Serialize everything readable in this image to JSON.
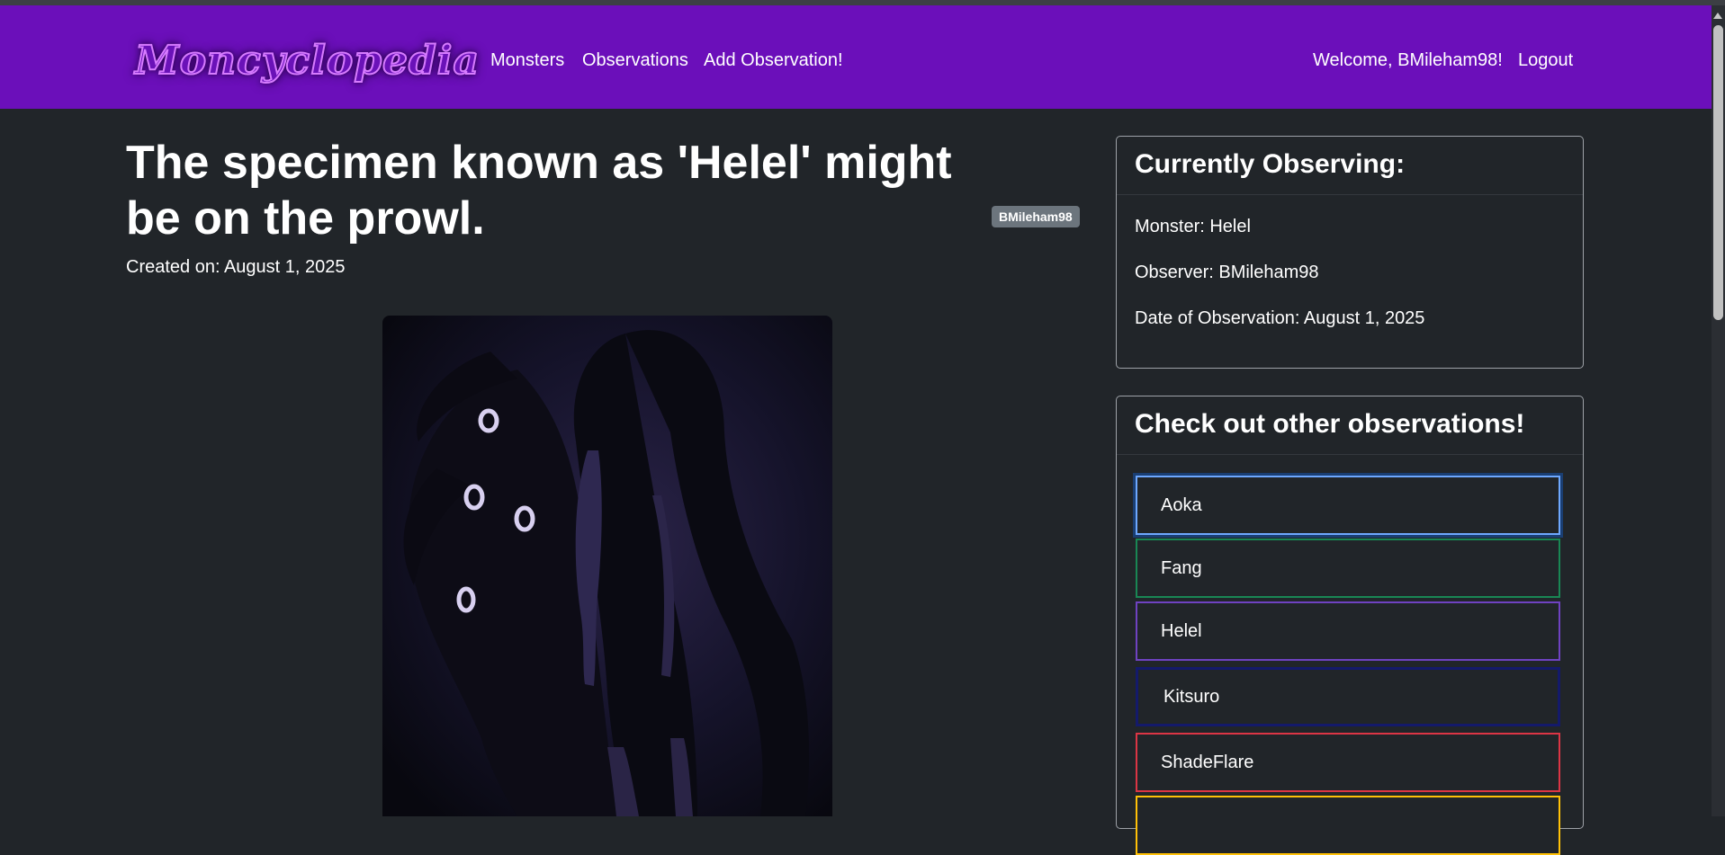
{
  "brand": {
    "logo_text": "Moncyclopedia"
  },
  "nav": {
    "links": [
      "Monsters",
      "Observations",
      "Add Observation!"
    ],
    "welcome": "Welcome, BMileham98!",
    "logout": "Logout"
  },
  "observation": {
    "title": "The specimen known as 'Helel' might be on the prowl.",
    "author_badge": "BMileham98",
    "created": "Created on: August 1, 2025",
    "image_alt": "Helel"
  },
  "current": {
    "header": "Currently Observing:",
    "monster": "Monster: Helel",
    "observer": "Observer: BMileham98",
    "date": "Date of Observation: August 1, 2025"
  },
  "others": {
    "header": "Check out other observations!",
    "items": [
      {
        "label": "Aoka",
        "border": "#6ea8fe"
      },
      {
        "label": "Fang",
        "border": "#198754"
      },
      {
        "label": "Helel",
        "border": "#6f42c1"
      },
      {
        "label": "Kitsuro",
        "border": "#141a6b"
      },
      {
        "label": "ShadeFlare",
        "border": "#dc3545"
      },
      {
        "label": "",
        "border": "#ffc107"
      }
    ]
  },
  "colors": {
    "navbar": "#6b0fba",
    "background": "#212529",
    "badge": "#6c757d"
  }
}
